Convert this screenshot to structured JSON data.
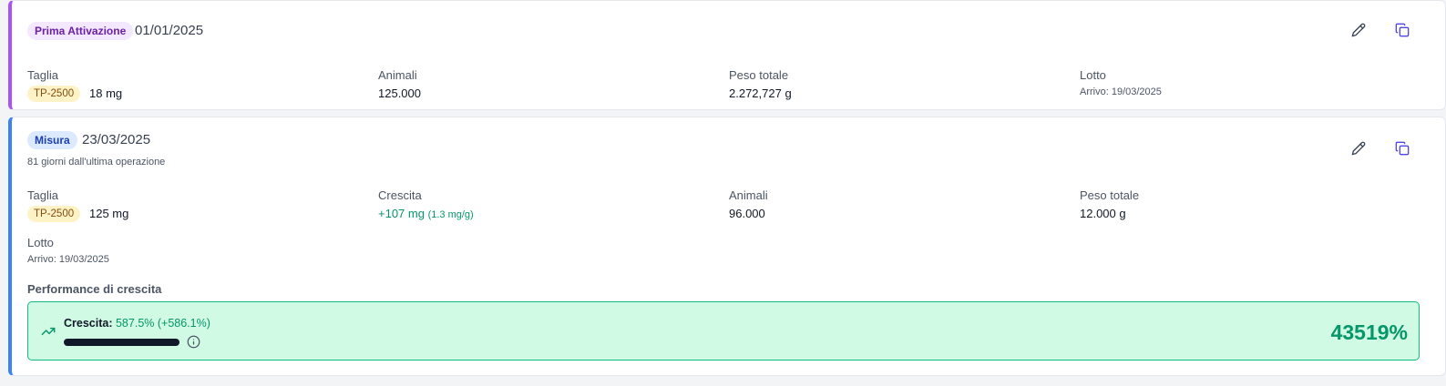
{
  "operations": [
    {
      "type_label": "Prima Attivazione",
      "date": "01/01/2025",
      "fields": {
        "taglia_label": "Taglia",
        "taglia_code": "TP-2500",
        "taglia_weight": "18 mg",
        "animali_label": "Animali",
        "animali_value": "125.000",
        "peso_label": "Peso totale",
        "peso_value": "2.272,727 g",
        "lotto_label": "Lotto",
        "lotto_arrival": "Arrivo: 19/03/2025"
      }
    },
    {
      "type_label": "Misura",
      "date": "23/03/2025",
      "days_since": "81 giorni dall'ultima operazione",
      "fields": {
        "taglia_label": "Taglia",
        "taglia_code": "TP-2500",
        "taglia_weight": "125 mg",
        "crescita_label": "Crescita",
        "crescita_value": "+107 mg",
        "crescita_rate": "(1.3 mg/g)",
        "animali_label": "Animali",
        "animali_value": "96.000",
        "peso_label": "Peso totale",
        "peso_value": "12.000 g",
        "lotto_label": "Lotto",
        "lotto_arrival": "Arrivo: 19/03/2025"
      },
      "performance": {
        "title": "Performance di crescita",
        "label": "Crescita:",
        "value": "587.5% (+586.1%)",
        "bar_fraction": 1.0,
        "percentage": "43519%"
      }
    }
  ],
  "colors": {
    "prima_attivazione_accent": "#a855f7",
    "misura_accent": "#3b82f6",
    "growth_green": "#059669",
    "performance_bg": "#d1fae5",
    "size_badge_bg": "#fef3c7"
  },
  "icons": {
    "edit": "pencil-icon",
    "duplicate": "copy-icon",
    "trend": "trending-up-icon",
    "info": "info-icon"
  }
}
